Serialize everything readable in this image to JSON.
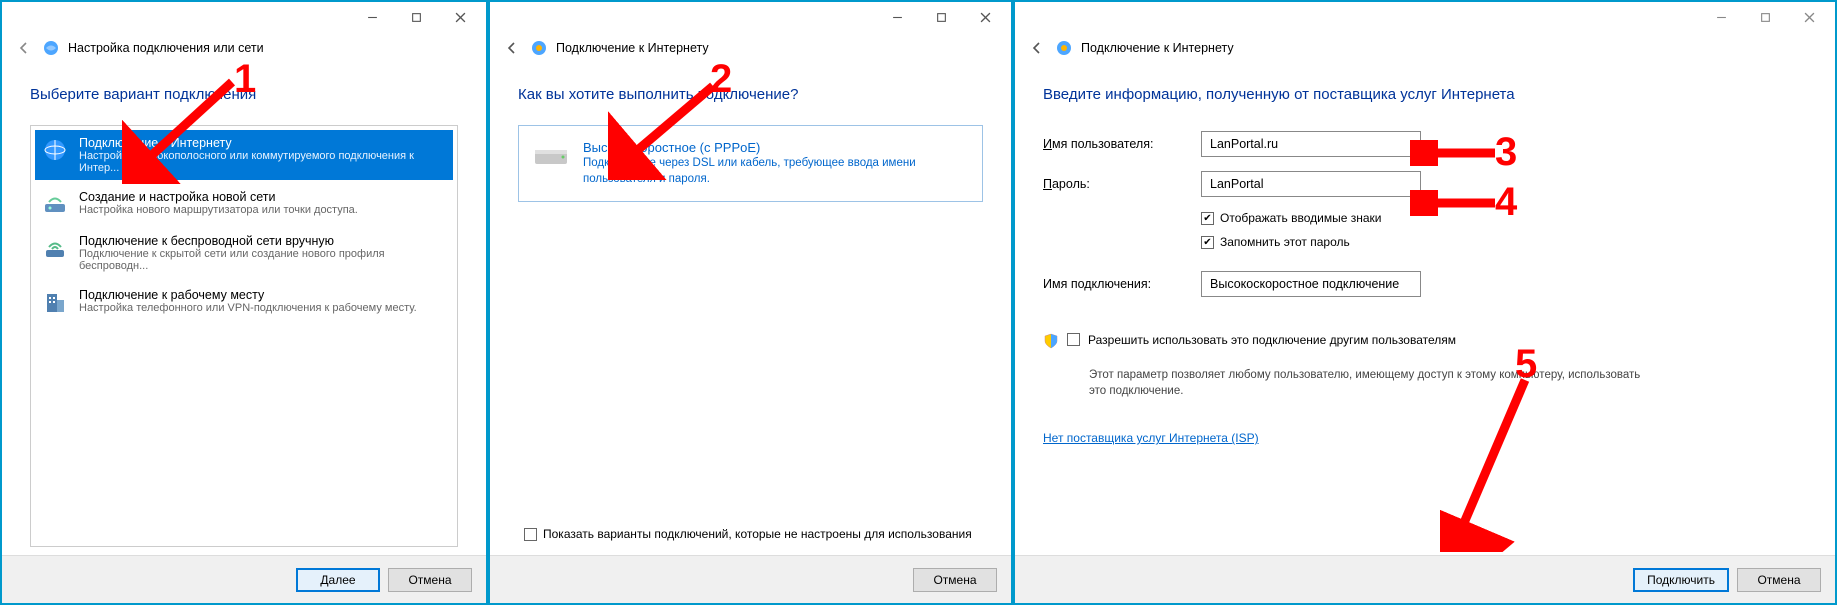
{
  "panel1": {
    "header_title": "Настройка подключения или сети",
    "heading": "Выберите вариант подключения",
    "options": [
      {
        "title": "Подключение к Интернету",
        "desc": "Настройка широкополосного или коммутируемого подключения к Интер..."
      },
      {
        "title": "Создание и настройка новой сети",
        "desc": "Настройка нового маршрутизатора или точки доступа."
      },
      {
        "title": "Подключение к беспроводной сети вручную",
        "desc": "Подключение к скрытой сети или создание нового профиля беспроводн..."
      },
      {
        "title": "Подключение к рабочему месту",
        "desc": "Настройка телефонного или VPN-подключения к рабочему месту."
      }
    ],
    "btn_next": "Далее",
    "btn_cancel": "Отмена"
  },
  "panel2": {
    "header_title": "Подключение к Интернету",
    "heading": "Как вы хотите выполнить подключение?",
    "choice_title": "Высокоскоростное (с PPPoE)",
    "choice_desc": "Подключение через DSL или кабель, требующее ввода имени пользователя и пароля.",
    "show_all_label": "Показать варианты подключений, которые не настроены для использования",
    "btn_cancel": "Отмена"
  },
  "panel3": {
    "header_title": "Подключение к Интернету",
    "heading": "Введите информацию, полученную от поставщика услуг Интернета",
    "labels": {
      "username": "Имя пользователя:",
      "password": "Пароль:",
      "connection_name": "Имя подключения:",
      "show_chars": "Отображать вводимые знаки",
      "remember": "Запомнить этот пароль",
      "allow_others_prefix": "Р",
      "allow_others_rest": "азрешить использовать это подключение другим пользователям",
      "allow_sub": "Этот параметр позволяет любому пользователю, имеющему доступ к этому компьютеру, использовать это подключение."
    },
    "values": {
      "username": "LanPortal.ru",
      "password": "LanPortal",
      "connection_name": "Высокоскоростное подключение"
    },
    "link": "Нет поставщика услуг Интернета (ISP)",
    "btn_connect": "Подключить",
    "btn_cancel": "Отмена"
  },
  "annot": {
    "n1": "1",
    "n2": "2",
    "n3": "3",
    "n4": "4",
    "n5": "5"
  }
}
